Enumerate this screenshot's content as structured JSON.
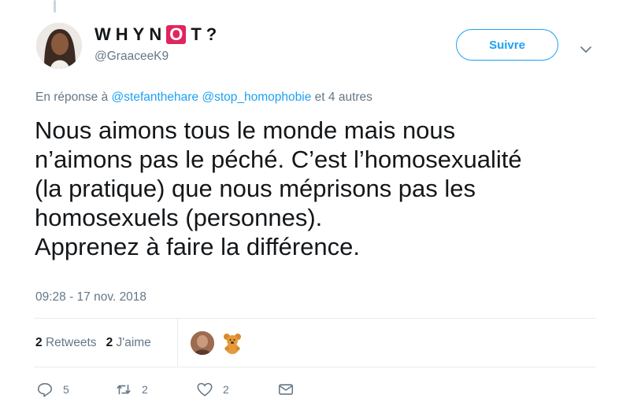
{
  "author": {
    "display_name_prefix": "WHYN",
    "display_name_boxed": "O",
    "display_name_suffix": "T?",
    "handle": "@GraaceeK9"
  },
  "follow_button_label": "Suivre",
  "reply": {
    "prefix": "En réponse à",
    "mention_1": "@stefanthehare",
    "mention_2": "@stop_homophobie",
    "suffix": "et 4 autres"
  },
  "tweet_text": "Nous aimons tous le monde mais nous\nn’aimons pas le péché. C’est l’homosexualité\n(la pratique) que nous méprisons pas les\nhomosexuels (personnes).\nApprenez à faire la différence.",
  "timestamp": "09:28 - 17 nov. 2018",
  "stats": {
    "retweets_count": "2",
    "retweets_label": "Retweets",
    "likes_count": "2",
    "likes_label": "J'aime"
  },
  "actions": {
    "reply_count": "5",
    "retweet_count": "2",
    "like_count": "2"
  },
  "icons": {
    "reply": "reply-icon",
    "retweet": "retweet-icon",
    "like": "heart-icon",
    "dm": "envelope-icon",
    "more": "chevron-down-icon"
  },
  "colors": {
    "accent": "#1da1f2",
    "text": "#14171a",
    "muted": "#657786",
    "name_box": "#e0245e"
  }
}
